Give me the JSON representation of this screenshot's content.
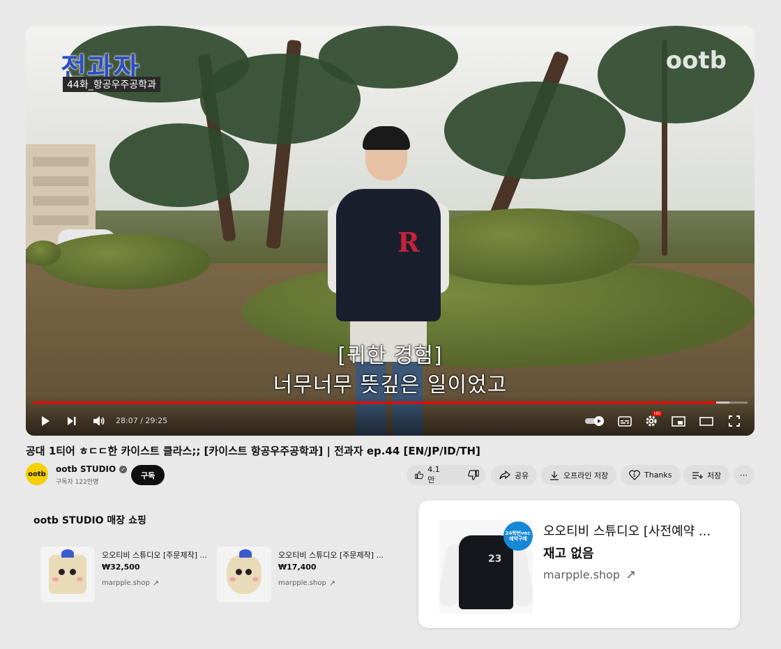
{
  "player": {
    "overlay_title": "전과자",
    "overlay_episode": "44화_항공우주공학과",
    "overlay_brand": "ootb",
    "subtitle_line1": "[귀한 경험]",
    "subtitle_line2": "너무너무 뜻깊은 일이었고",
    "time_display": "28:07 / 29:25",
    "progress_fraction": 0.956,
    "loaded_fraction": 0.975,
    "hd_badge": "HD",
    "accent_color": "#ff0000"
  },
  "video": {
    "title": "공대 1티어 ㅎㄷㄷ한 카이스트 클라스;; [카이스트 항공우주공학과] | 전과자 ep.44 [EN/JP/ID/TH]"
  },
  "channel": {
    "avatar_text": "ootb",
    "name": "ootb STUDIO",
    "subscribers": "구독자 122만명",
    "subscribe_label": "구독"
  },
  "actions": {
    "like_count": "4.1만",
    "share_label": "공유",
    "download_label": "오프라인 저장",
    "thanks_label": "Thanks",
    "save_label": "저장",
    "more_label": "⋯"
  },
  "shop": {
    "heading": "ootb STUDIO 매장 쇼핑",
    "items": [
      {
        "name": "오오티비 스튜디오 [주문제작] ...",
        "price": "₩32,500",
        "site": "marpple.shop"
      },
      {
        "name": "오오티비 스튜디오 [주문제작] ...",
        "price": "₩17,400",
        "site": "marpple.shop"
      }
    ]
  },
  "product": {
    "name": "오오티비 스튜디오 [사전예약 ...",
    "stock": "재고 없음",
    "site": "marpple.shop",
    "badge_line1": "24학번ver.",
    "badge_line2": "예약구매",
    "jacket_number": "23"
  }
}
